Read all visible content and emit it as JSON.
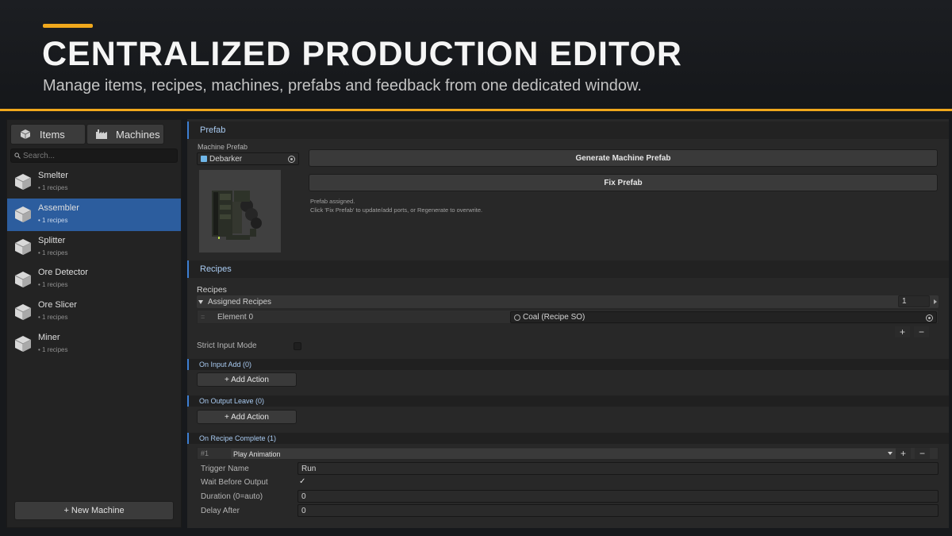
{
  "header": {
    "title": "CENTRALIZED PRODUCTION EDITOR",
    "subtitle": "Manage items, recipes, machines, prefabs and feedback from one dedicated window."
  },
  "sidebar": {
    "tabs": [
      {
        "label": "Items",
        "icon": "cube-icon"
      },
      {
        "label": "Machines",
        "icon": "factory-icon"
      }
    ],
    "search_placeholder": "Search...",
    "items": [
      {
        "name": "Smelter",
        "sub": "• 1 recipes",
        "selected": false
      },
      {
        "name": "Assembler",
        "sub": "• 1 recipes",
        "selected": true
      },
      {
        "name": "Splitter",
        "sub": "• 1 recipes",
        "selected": false
      },
      {
        "name": "Ore Detector",
        "sub": "• 1 recipes",
        "selected": false
      },
      {
        "name": "Ore Slicer",
        "sub": "• 1 recipes",
        "selected": false
      },
      {
        "name": "Miner",
        "sub": "• 1 recipes",
        "selected": false
      }
    ],
    "new_button": "+ New Machine"
  },
  "prefab": {
    "section_title": "Prefab",
    "field_label": "Machine Prefab",
    "field_value": "Debarker",
    "generate_button": "Generate Machine Prefab",
    "fix_button": "Fix Prefab",
    "note_line1": "Prefab assigned.",
    "note_line2": "Click 'Fix Prefab' to update/add ports, or Regenerate to overwrite."
  },
  "recipes": {
    "section_title": "Recipes",
    "label": "Recipes",
    "array_label": "Assigned Recipes",
    "array_count": "1",
    "element_label": "Element 0",
    "element_value": "Coal (Recipe SO)",
    "strict_label": "Strict Input Mode",
    "strict_checked": false
  },
  "events": {
    "on_input_add": "On Input Add  (0)",
    "on_output_leave": "On Output Leave  (0)",
    "on_recipe_complete": "On Recipe Complete  (1)",
    "add_action": "+ Add Action"
  },
  "action": {
    "index": "#1",
    "type": "Play Animation",
    "fields": [
      {
        "label": "Trigger Name",
        "value": "Run"
      },
      {
        "label": "Wait Before Output",
        "value": "✓"
      },
      {
        "label": "Duration (0=auto)",
        "value": "0"
      },
      {
        "label": "Delay After",
        "value": "0"
      }
    ]
  },
  "colors": {
    "accent": "#f0a81c",
    "selection": "#2c5d9e",
    "section_border": "#3d7fd3"
  }
}
